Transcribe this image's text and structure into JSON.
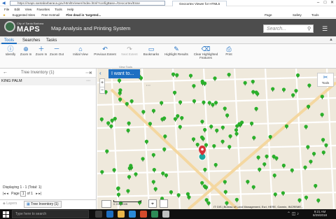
{
  "browser": {
    "address_url": "https://maps.santabarbaraca.gov/Html5Viewer/Index.html?configBase=/Geocortex/Esse",
    "tab_title": "Geocortex Viewer for HTML5",
    "menu": [
      "File",
      "Edit",
      "View",
      "Favorites",
      "Tools",
      "Help"
    ],
    "favorites": [
      "Suggested Sites",
      "Free Hotmail",
      "Flee dead in 'targeted..."
    ],
    "right_tools": [
      "Page",
      "Safety",
      "Tools"
    ]
  },
  "app": {
    "logo_top": "City of Santa Barbara",
    "logo_text": "MAPS",
    "title": "Map Analysis and Printing System",
    "search_placeholder": "Search..."
  },
  "tabs": [
    "Tools",
    "Searches",
    "Tasks"
  ],
  "ribbon_tools": [
    {
      "label": "Identify",
      "icon": "identify-icon"
    },
    {
      "label": "Zoom In",
      "icon": "zoom-in-icon"
    },
    {
      "label": "Zoom In",
      "icon": "plus-icon"
    },
    {
      "label": "Zoom Out",
      "icon": "minus-icon"
    },
    {
      "label": "Initial View",
      "icon": "home-icon"
    },
    {
      "label": "Previous Extent",
      "icon": "arrow-left-icon"
    },
    {
      "label": "Next Extent",
      "icon": "arrow-right-icon"
    },
    {
      "label": "Bookmarks",
      "icon": "bookmark-icon"
    },
    {
      "label": "Highlight Results",
      "icon": "highlight-icon"
    },
    {
      "label": "Clear Highlighted Features",
      "icon": "clear-icon"
    },
    {
      "label": "Print",
      "icon": "print-icon"
    }
  ],
  "ribbon_group": "View Tools",
  "panel": {
    "title": "Tree Inventory (1)",
    "item": "KING PALM",
    "displaying": "Displaying 1 - 1 (Total: 1)",
    "page": "Page",
    "page_value": "1",
    "page_of": "of 1",
    "bottom_tabs": [
      "Layers",
      "Tree Inventory (1)"
    ]
  },
  "map": {
    "iwant": "I want to...",
    "tools_label": "Tools",
    "attribution": "IT GIS | Bureau of Land Management, Esri, HERE, Garmin, INCREME...",
    "scale": "0      200     400ft"
  },
  "taskbar": {
    "search": "Type here to search",
    "time": "9:21 AM",
    "date": "8/29/2018"
  },
  "colors": {
    "accent": "#1e6fc2",
    "header": "#4d4d4d",
    "tree": "#2bb02b"
  }
}
